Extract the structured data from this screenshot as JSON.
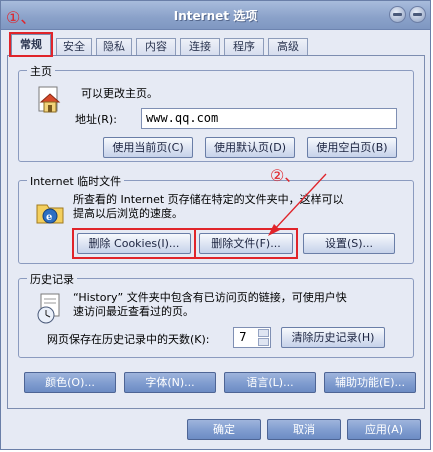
{
  "window": {
    "title": "Internet 选项"
  },
  "annotations": {
    "step1": "①、",
    "step2": "②、",
    "color": "#e0242a"
  },
  "tabs": [
    {
      "label": "常规",
      "active": true
    },
    {
      "label": "安全"
    },
    {
      "label": "隐私"
    },
    {
      "label": "内容"
    },
    {
      "label": "连接"
    },
    {
      "label": "程序"
    },
    {
      "label": "高级"
    }
  ],
  "homepage": {
    "group_label": "主页",
    "description": "可以更改主页。",
    "address_label": "地址(R):",
    "address_value": "www.qq.com",
    "buttons": {
      "use_current": "使用当前页(C)",
      "use_default": "使用默认页(D)",
      "use_blank": "使用空白页(B)"
    }
  },
  "temp_files": {
    "group_label": "Internet 临时文件",
    "description_line1": "所查看的 Internet 页存储在特定的文件夹中，这样可以",
    "description_line2": "提高以后浏览的速度。",
    "buttons": {
      "delete_cookies": "删除 Cookies(I)...",
      "delete_files": "删除文件(F)...",
      "settings": "设置(S)..."
    }
  },
  "history": {
    "group_label": "历史记录",
    "description_line1": "“History” 文件夹中包含有已访问页的链接，可使用户快",
    "description_line2": "速访问最近查看过的页。",
    "days_label": "网页保存在历史记录中的天数(K):",
    "days_value": "7",
    "clear_button": "清除历史记录(H)"
  },
  "bottom_row": {
    "colors": "颜色(O)...",
    "fonts": "字体(N)...",
    "languages": "语言(L)...",
    "accessibility": "辅助功能(E)..."
  },
  "dialog_buttons": {
    "ok": "确定",
    "cancel": "取消",
    "apply": "应用(A)"
  },
  "colors": {
    "frame": "#6a7fa8",
    "panel": "#e6eaf4",
    "titlebar": "#8aa1c9",
    "annotation": "#e0242a"
  }
}
